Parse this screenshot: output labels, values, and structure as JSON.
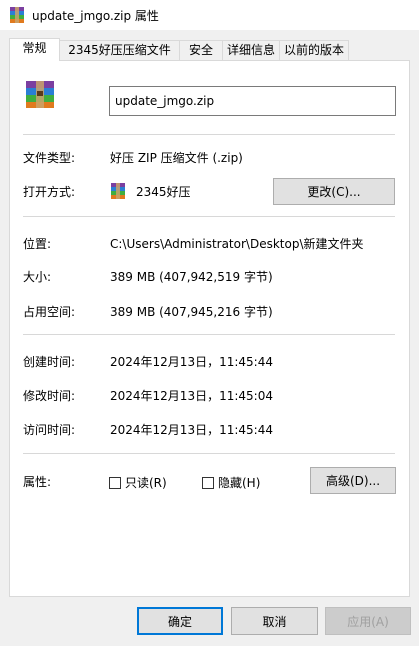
{
  "window": {
    "title": "update_jmgo.zip 属性"
  },
  "tabs": [
    {
      "label": "常规",
      "active": true
    },
    {
      "label": "2345好压压缩文件"
    },
    {
      "label": "安全"
    },
    {
      "label": "详细信息"
    },
    {
      "label": "以前的版本"
    }
  ],
  "general": {
    "file_name": "update_jmgo.zip",
    "file_type_label": "文件类型:",
    "file_type_value": "好压 ZIP 压缩文件 (.zip)",
    "open_with_label": "打开方式:",
    "open_with_value": "2345好压",
    "change_button": "更改(C)...",
    "location_label": "位置:",
    "location_value": "C:\\Users\\Administrator\\Desktop\\新建文件夹",
    "size_label": "大小:",
    "size_value": "389 MB (407,942,519 字节)",
    "size_on_disk_label": "占用空间:",
    "size_on_disk_value": "389 MB (407,945,216 字节)",
    "created_label": "创建时间:",
    "created_value": "2024年12月13日，11:45:44",
    "modified_label": "修改时间:",
    "modified_value": "2024年12月13日，11:45:04",
    "accessed_label": "访问时间:",
    "accessed_value": "2024年12月13日，11:45:44",
    "attributes_label": "属性:",
    "readonly_label": "只读(R)",
    "hidden_label": "隐藏(H)",
    "advanced_button": "高级(D)..."
  },
  "footer": {
    "ok": "确定",
    "cancel": "取消",
    "apply": "应用(A)"
  },
  "icons": {
    "archive": "winrar-style-archive-icon"
  }
}
